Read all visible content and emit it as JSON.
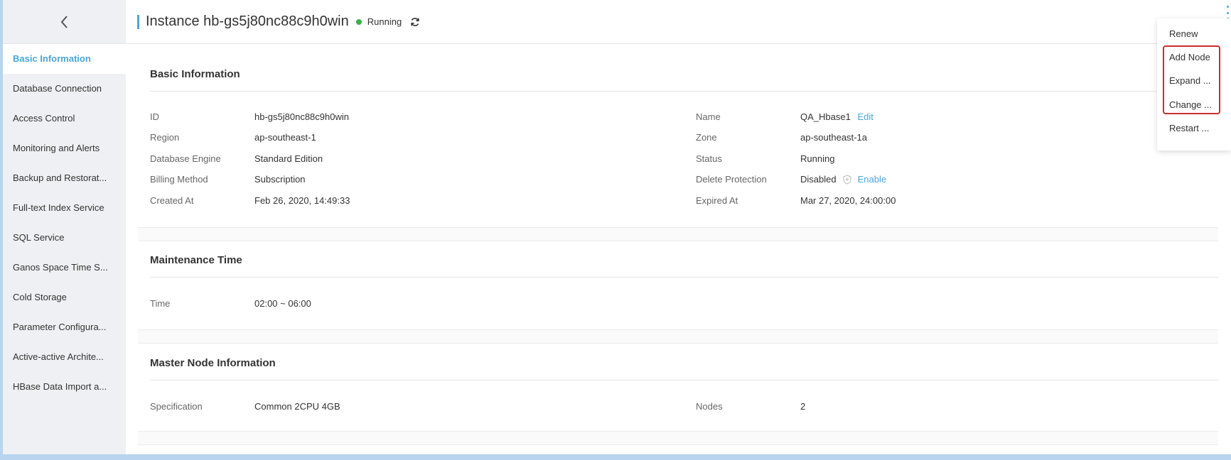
{
  "header": {
    "title": "Instance hb-gs5j80nc88c9h0win",
    "status": "Running",
    "status_color": "#3cae4a",
    "refresh_icon": "refresh-icon",
    "more_icon": "more-vertical-icon"
  },
  "sidebar": {
    "back_icon": "chevron-left-icon",
    "items": [
      {
        "label": "Basic Information",
        "active": true
      },
      {
        "label": "Database Connection"
      },
      {
        "label": "Access Control"
      },
      {
        "label": "Monitoring and Alerts"
      },
      {
        "label": "Backup and Restorat..."
      },
      {
        "label": "Full-text Index Service"
      },
      {
        "label": "SQL Service"
      },
      {
        "label": "Ganos Space Time S..."
      },
      {
        "label": "Cold Storage"
      },
      {
        "label": "Parameter Configura..."
      },
      {
        "label": "Active-active Archite..."
      },
      {
        "label": "HBase Data Import a..."
      }
    ]
  },
  "basic": {
    "title": "Basic Information",
    "left": [
      {
        "label": "ID",
        "value": "hb-gs5j80nc88c9h0win"
      },
      {
        "label": "Region",
        "value": "ap-southeast-1"
      },
      {
        "label": "Database Engine",
        "value": "Standard Edition"
      },
      {
        "label": "Billing Method",
        "value": "Subscription"
      },
      {
        "label": "Created At",
        "value": "Feb 26, 2020, 14:49:33"
      }
    ],
    "right": [
      {
        "label": "Name",
        "value": "QA_Hbase1",
        "action": "Edit"
      },
      {
        "label": "Zone",
        "value": "ap-southeast-1a"
      },
      {
        "label": "Status",
        "value": "Running"
      },
      {
        "label": "Delete Protection",
        "value": "Disabled",
        "icon": "shield-icon",
        "action": "Enable"
      },
      {
        "label": "Expired At",
        "value": "Mar 27, 2020, 24:00:00"
      }
    ]
  },
  "maintenance": {
    "title": "Maintenance Time",
    "label": "Time",
    "value": "02:00 ~ 06:00"
  },
  "master": {
    "title": "Master Node Information",
    "spec_label": "Specification",
    "spec_value": "Common 2CPU 4GB",
    "nodes_label": "Nodes",
    "nodes_value": "2"
  },
  "menu": {
    "items": [
      "Renew",
      "Add Node",
      "Expand ...",
      "Change ...",
      "Restart ..."
    ]
  },
  "colors": {
    "accent": "#4aa6d8",
    "highlight": "#c9302c"
  }
}
